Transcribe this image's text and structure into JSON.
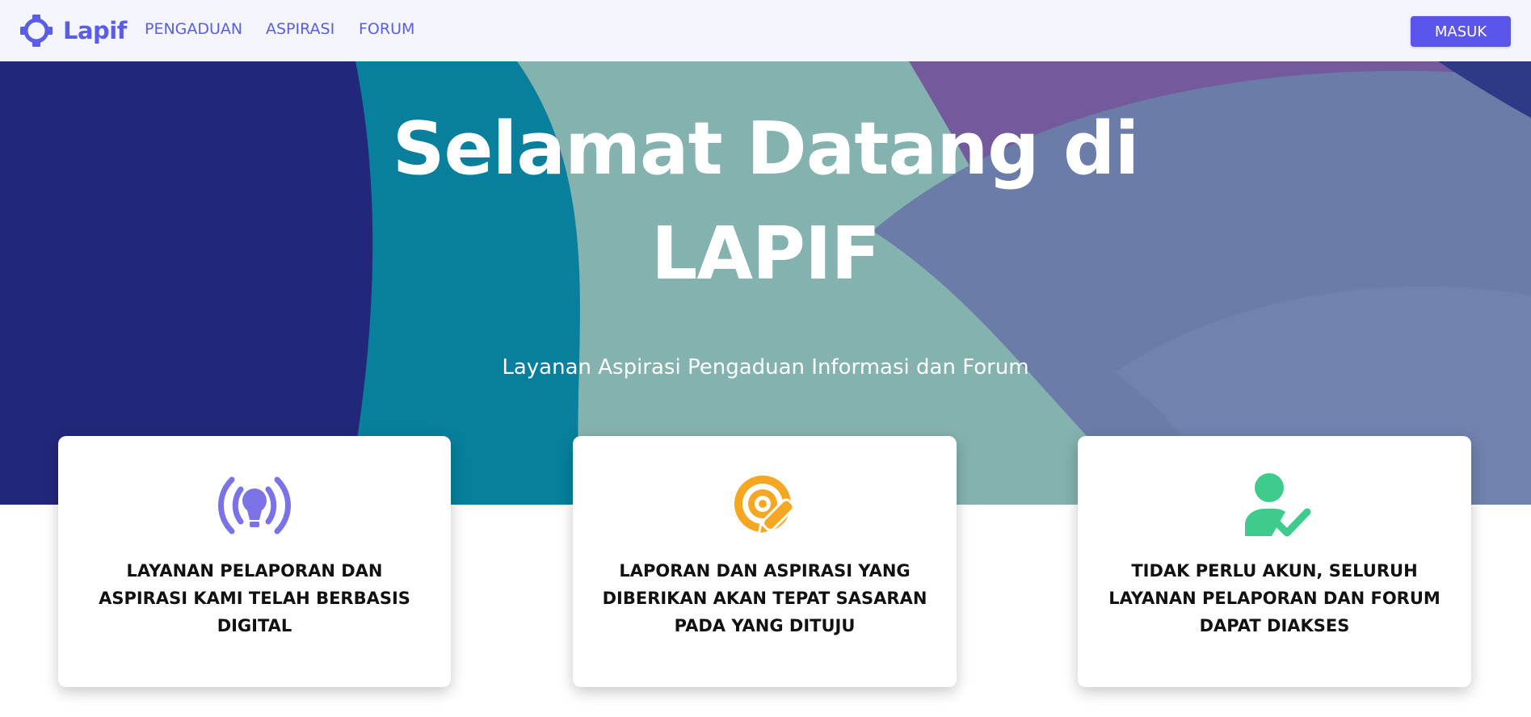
{
  "navbar": {
    "brand": "Lapif",
    "links": [
      {
        "label": "PENGADUAN"
      },
      {
        "label": "ASPIRASI"
      },
      {
        "label": "FORUM"
      }
    ],
    "login_label": "MASUK"
  },
  "hero": {
    "title_line1": "Selamat Datang di",
    "title_line2": "LAPIF",
    "subtitle": "Layanan Aspirasi Pengaduan Informasi dan Forum"
  },
  "cards": [
    {
      "icon": "broadcast-bulb-icon",
      "text": "LAYANAN PELAPORAN DAN ASPIRASI KAMI TELAH BERBASIS DIGITAL"
    },
    {
      "icon": "target-pencil-icon",
      "text": "LAPORAN DAN ASPIRASI YANG DIBERIKAN AKAN TEPAT SASARAN PADA YANG DITUJU"
    },
    {
      "icon": "user-check-icon",
      "text": "TIDAK PERLU AKUN, SELURUH LAYANAN PELAPORAN DAN FORUM DAPAT DIAKSES"
    }
  ],
  "colors": {
    "brand": "#5a5de6",
    "button": "#5b55ec",
    "hero_navy": "#22277a",
    "hero_teal": "#087f9c",
    "hero_mint": "#84b2ae",
    "hero_purple": "#745a9c",
    "hero_slate": "#6b7ca9",
    "icon_purple": "#7a72e6",
    "icon_orange": "#f5a623",
    "icon_green": "#3ecb8c"
  }
}
